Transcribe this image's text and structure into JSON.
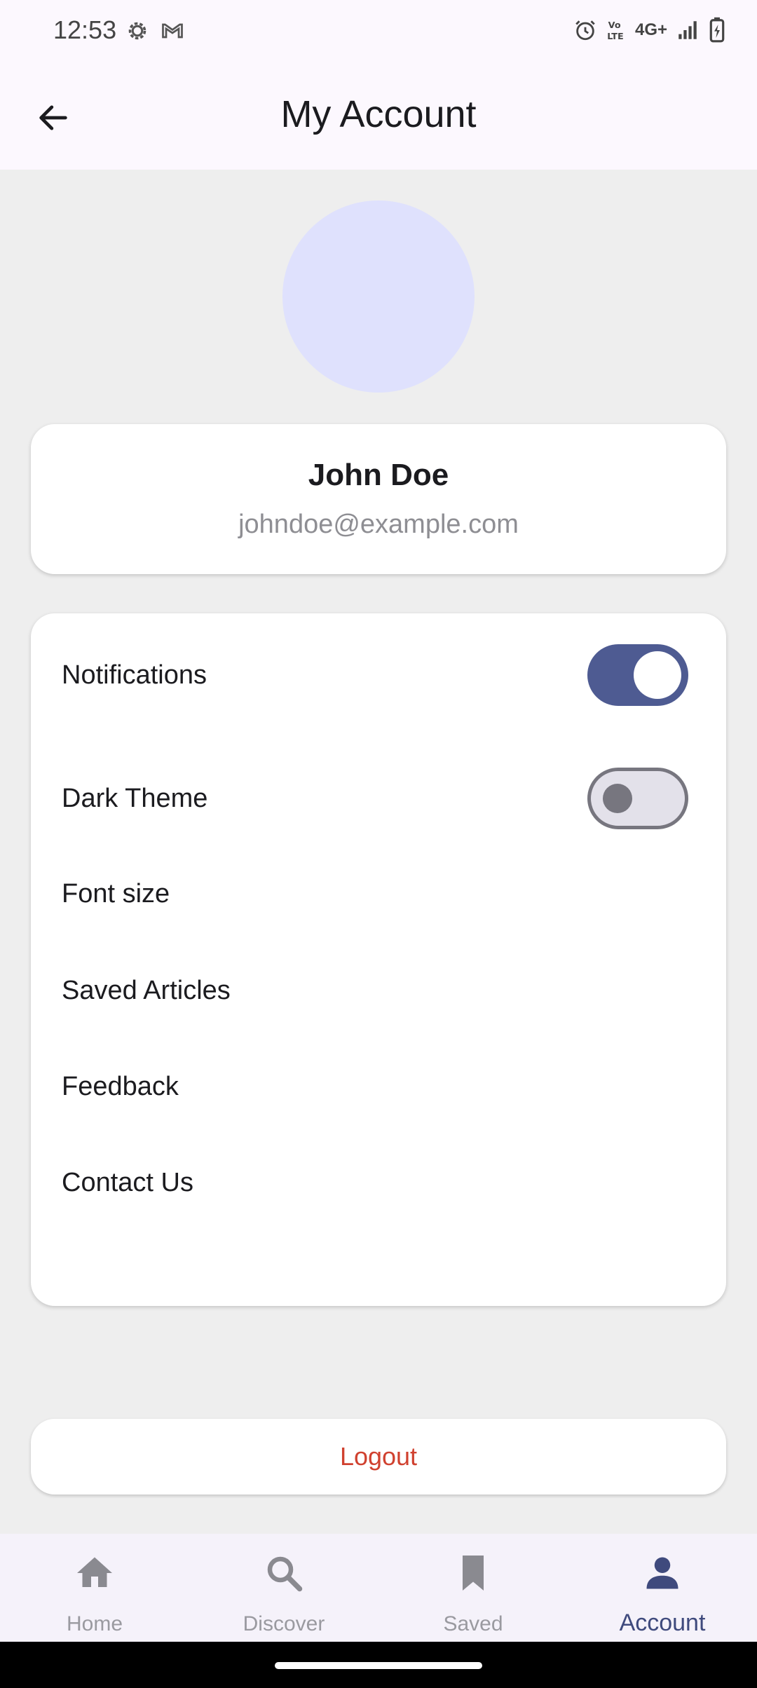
{
  "status_bar": {
    "time": "12:53",
    "left_icons": [
      "settings-icon",
      "gmail-icon"
    ],
    "right_icons": [
      "alarm-icon",
      "volte-icon",
      "4g-plus-icon",
      "signal-icon",
      "battery-charging-icon"
    ],
    "network_label": "4G+"
  },
  "header": {
    "title": "My Account",
    "back_icon": "arrow-left-icon"
  },
  "profile": {
    "name": "John Doe",
    "email": "johndoe@example.com",
    "avatar_color": "#dfe1fd"
  },
  "settings": {
    "items": [
      {
        "label": "Notifications",
        "control": "switch",
        "checked": true
      },
      {
        "label": "Dark Theme",
        "control": "switch",
        "checked": false
      },
      {
        "label": "Font size"
      },
      {
        "label": "Saved Articles"
      },
      {
        "label": "Feedback"
      },
      {
        "label": "Contact Us"
      }
    ]
  },
  "logout": {
    "label": "Logout",
    "color": "#d0412f"
  },
  "bottom_nav": {
    "items": [
      {
        "label": "Home",
        "icon": "home-icon",
        "active": false
      },
      {
        "label": "Discover",
        "icon": "search-icon",
        "active": false
      },
      {
        "label": "Saved",
        "icon": "bookmark-icon",
        "active": false
      },
      {
        "label": "Account",
        "icon": "person-icon",
        "active": true
      }
    ]
  },
  "colors": {
    "accent": "#4e5b92",
    "active_nav": "#3f4a7d",
    "inactive_nav": "#9a9aa0"
  }
}
